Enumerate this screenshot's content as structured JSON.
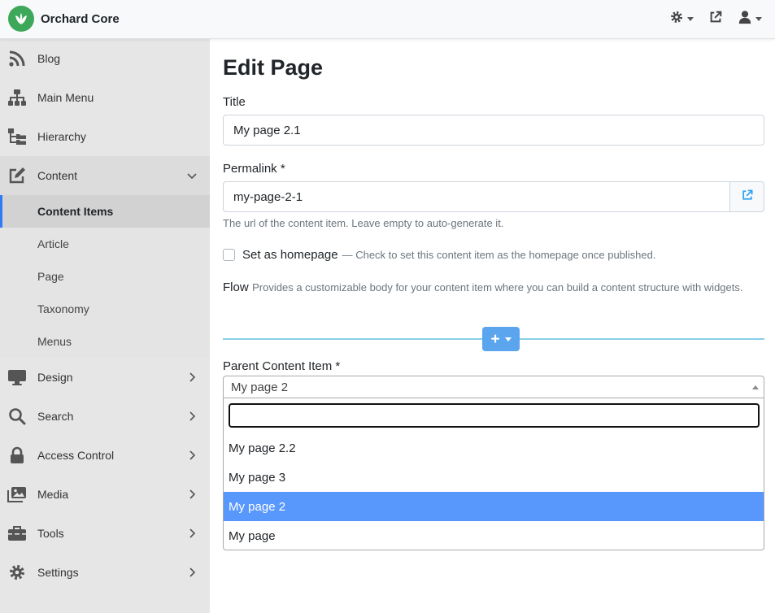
{
  "app": {
    "title": "Orchard Core"
  },
  "header": {
    "icons": [
      "gear-icon",
      "external-link-icon",
      "user-icon"
    ]
  },
  "sidebar": {
    "items": [
      {
        "label": "Blog",
        "icon": "rss-icon"
      },
      {
        "label": "Main Menu",
        "icon": "sitemap-icon"
      },
      {
        "label": "Hierarchy",
        "icon": "folder-tree-icon"
      },
      {
        "label": "Content",
        "icon": "edit-icon",
        "expanded": true,
        "children": [
          {
            "label": "Content Items",
            "active": true
          },
          {
            "label": "Article"
          },
          {
            "label": "Page"
          },
          {
            "label": "Taxonomy"
          },
          {
            "label": "Menus"
          }
        ]
      },
      {
        "label": "Design",
        "icon": "desktop-icon"
      },
      {
        "label": "Search",
        "icon": "search-icon"
      },
      {
        "label": "Access Control",
        "icon": "lock-icon"
      },
      {
        "label": "Media",
        "icon": "images-icon"
      },
      {
        "label": "Tools",
        "icon": "toolbox-icon"
      },
      {
        "label": "Settings",
        "icon": "cog-icon"
      }
    ]
  },
  "main": {
    "page_title": "Edit Page",
    "title_field": {
      "label": "Title",
      "value": "My page 2.1"
    },
    "permalink_field": {
      "label": "Permalink *",
      "value": "my-page-2-1",
      "hint": "The url of the content item. Leave empty to auto-generate it."
    },
    "homepage": {
      "label": "Set as homepage",
      "hint": "— Check to set this content item as the homepage once published.",
      "checked": false
    },
    "flow": {
      "title": "Flow",
      "description": "Provides a customizable body for your content item where you can build a content structure with widgets.",
      "add_label": "+"
    },
    "parent": {
      "label": "Parent Content Item *",
      "selected": "My page 2",
      "search_value": "",
      "options": [
        {
          "label": "My page 2.2",
          "highlighted": false
        },
        {
          "label": "My page 3",
          "highlighted": false
        },
        {
          "label": "My page 2",
          "highlighted": true
        },
        {
          "label": "My page",
          "highlighted": false
        }
      ]
    }
  },
  "colors": {
    "brand": "#3da859",
    "sidebar_bg": "#e6e6e6",
    "active_indicator": "#2d7cf6",
    "flow_line": "#87cfe8",
    "flow_button": "#5ba5ef",
    "option_highlight": "#5897fb",
    "link_icon": "#2ea3f2"
  }
}
